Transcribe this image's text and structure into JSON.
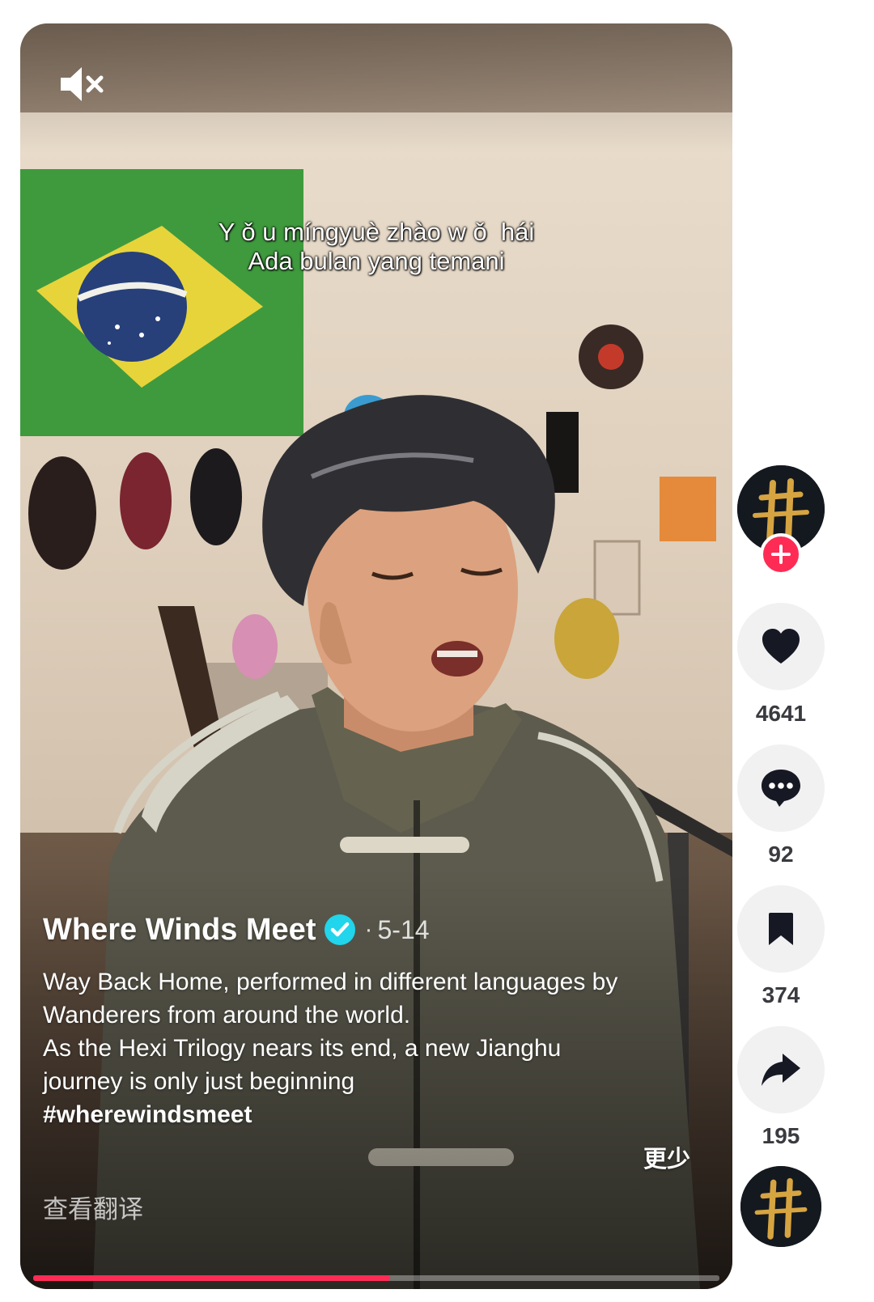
{
  "video": {
    "subtitles": {
      "line1": "Y ǒ u míngyuè zhào w ǒ  hái",
      "line2": "Ada bulan yang temani"
    },
    "mute_icon": "speaker-muted-icon",
    "progress_fraction": 0.52
  },
  "caption": {
    "author": "Where Winds Meet",
    "verified_icon": "verified-badge-icon",
    "dot": "·",
    "date": "5-14",
    "description_lines": [
      "Way Back Home, performed in different languages by",
      "Wanderers from around the world.",
      "As the Hexi Trilogy nears its end, a new Jianghu",
      "journey is only just beginning"
    ],
    "hashtag": "#wherewindsmeet",
    "less_label": "更少",
    "translate_label": "查看翻译"
  },
  "actions": {
    "like_count": "4641",
    "comment_count": "92",
    "save_count": "374",
    "share_count": "195"
  },
  "colors": {
    "accent": "#fe2c55",
    "verified": "#20d5ec",
    "rail_button_bg": "#f1f1f2",
    "count_text": "#3a3b40"
  }
}
